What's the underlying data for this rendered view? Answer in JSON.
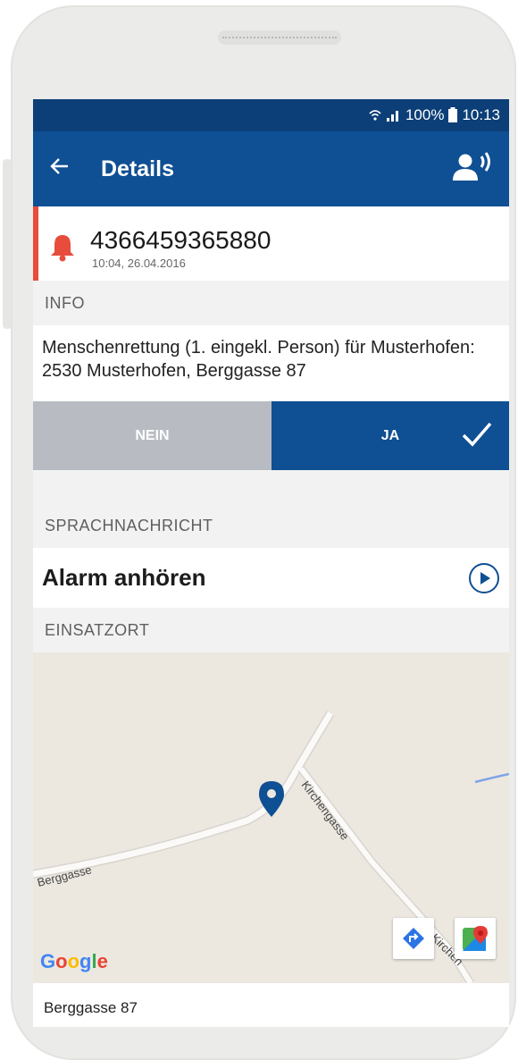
{
  "status_bar": {
    "battery": "100%",
    "time": "10:13"
  },
  "header": {
    "title": "Details",
    "back_icon": "back-arrow-icon",
    "action_icon": "speaking-person-icon"
  },
  "alert": {
    "number": "4366459365880",
    "timestamp": "10:04, 26.04.2016",
    "accent_color": "#e74c3c"
  },
  "info": {
    "section_label": "INFO",
    "text": "Menschenrettung (1. eingekl. Person) für Musterhofen: 2530 Musterhofen, Berggasse 87"
  },
  "response": {
    "no_label": "NEIN",
    "yes_label": "JA"
  },
  "voice": {
    "section_label": "SPRACHNACHRICHT",
    "label": "Alarm anhören"
  },
  "location": {
    "section_label": "EINSATZORT",
    "streets": [
      "Berggasse",
      "Kirchengasse",
      "Kirchen"
    ],
    "map_logo": "Google",
    "address": "Berggasse 87"
  },
  "colors": {
    "primary": "#0f4f93",
    "status_bar": "#0c3f77",
    "alert": "#e74c3c",
    "nein_button": "#b8bcc2"
  }
}
